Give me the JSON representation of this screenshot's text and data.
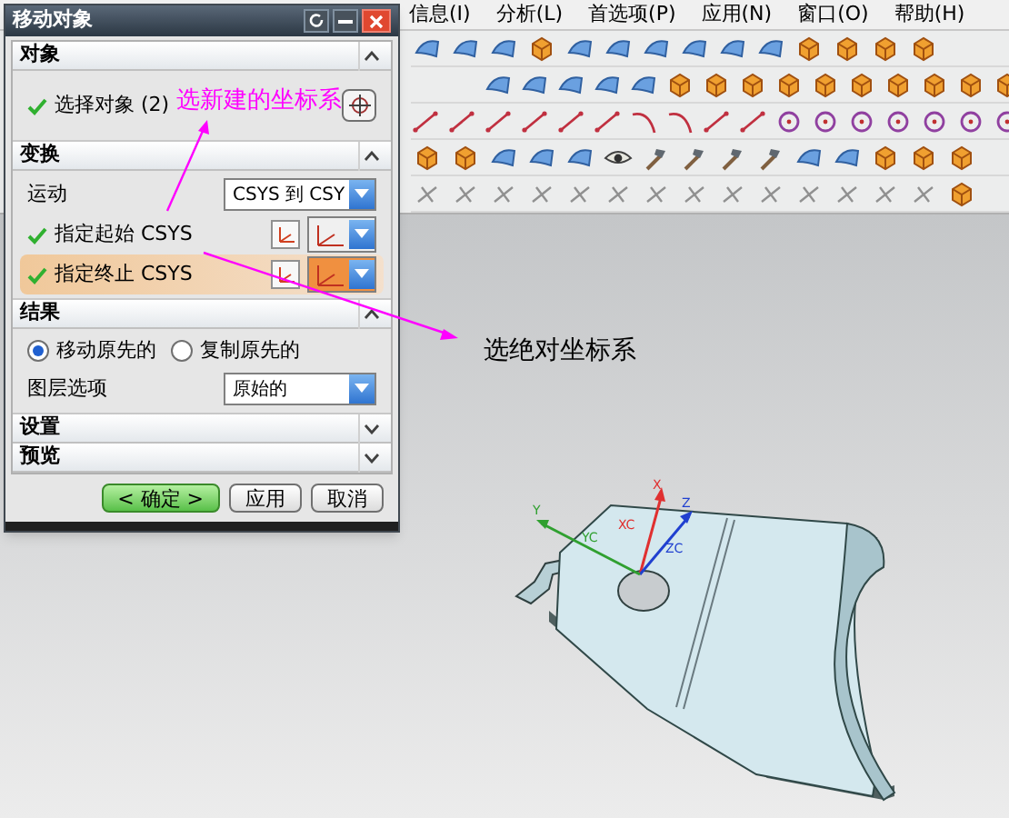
{
  "menu_bar": {
    "items": [
      "信息(I)",
      "分析(L)",
      "首选项(P)",
      "应用(N)",
      "窗口(O)",
      "帮助(H)"
    ]
  },
  "dialog": {
    "title": "移动对象",
    "sections": [
      {
        "title": "对象",
        "expanded": true,
        "rows": [
          {
            "kind": "select",
            "label": "选择对象 (2)",
            "done": true
          }
        ]
      },
      {
        "title": "变换",
        "expanded": true,
        "rows": [
          {
            "kind": "dropdown",
            "label": "运动",
            "value": "CSYS 到 CSY"
          },
          {
            "kind": "csys",
            "label": "指定起始 CSYS",
            "done": true,
            "selected": false
          },
          {
            "kind": "csys",
            "label": "指定终止 CSYS",
            "done": true,
            "selected": true
          }
        ]
      },
      {
        "title": "结果",
        "expanded": true,
        "rows": [
          {
            "kind": "radios",
            "options": [
              {
                "label": "移动原先的",
                "selected": true
              },
              {
                "label": "复制原先的",
                "selected": false
              }
            ]
          },
          {
            "kind": "dropdown",
            "label": "图层选项",
            "value": "原始的"
          }
        ]
      },
      {
        "title": "设置",
        "expanded": false
      },
      {
        "title": "预览",
        "expanded": false
      }
    ],
    "buttons": [
      {
        "label": "< 确定 >",
        "primary": true
      },
      {
        "label": "应用",
        "primary": false
      },
      {
        "label": "取消",
        "primary": false
      }
    ]
  },
  "annotations": [
    {
      "text": "选新建的坐标系",
      "color": "#ff00ff"
    },
    {
      "text": "选绝对坐标系",
      "color": "#000000"
    }
  ],
  "viewport": {
    "axes": [
      {
        "label": "X",
        "color": "#e03030"
      },
      {
        "label": "Z",
        "color": "#2040d0"
      },
      {
        "label": "Y",
        "color": "#30a030"
      }
    ],
    "axis_labels": [
      "XC",
      "YC",
      "ZC"
    ]
  }
}
